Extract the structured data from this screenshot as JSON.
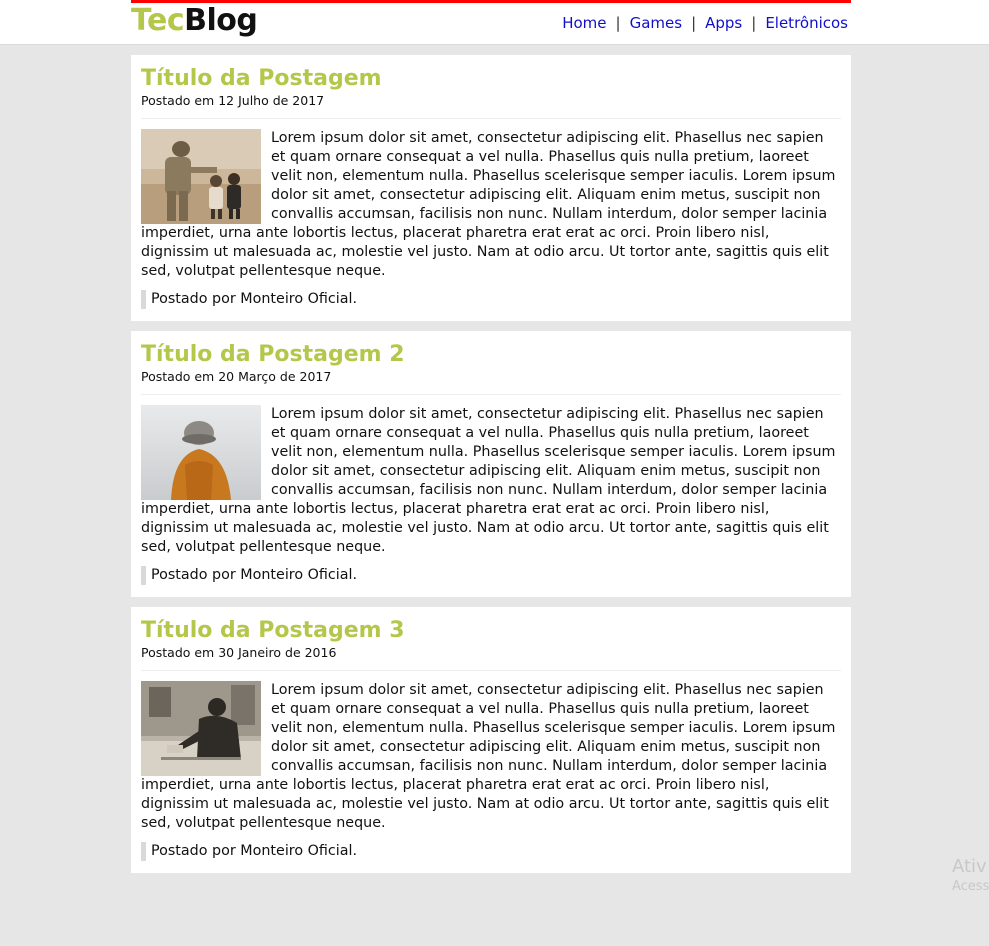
{
  "header": {
    "logo_part1": "Tec",
    "logo_part2": "Blog",
    "nav": [
      "Home",
      "Games",
      "Apps",
      "Eletrônicos"
    ],
    "separator": "|"
  },
  "posts": [
    {
      "title": "Título da Postagem",
      "date": "Postado em 12 Julho de 2017",
      "image": "soldier-with-children",
      "body": "Lorem ipsum dolor sit amet, consectetur adipiscing elit. Phasellus nec sapien et quam ornare consequat a vel nulla. Phasellus quis nulla pretium, laoreet velit non, elementum nulla. Phasellus scelerisque semper iaculis. Lorem ipsum dolor sit amet, consectetur adipiscing elit. Aliquam enim metus, suscipit non convallis accumsan, facilisis non nunc. Nullam interdum, dolor semper lacinia imperdiet, urna ante lobortis lectus, placerat pharetra erat erat ac orci. Proin libero nisl, dignissim ut malesuada ac, molestie vel justo. Nam at odio arcu. Ut tortor ante, sagittis quis elit sed, volutpat pellentesque neque.",
      "byline": "Postado por Monteiro Oficial."
    },
    {
      "title": "Título da Postagem 2",
      "date": "Postado em 20 Março de 2017",
      "image": "person-in-orange-jacket",
      "body": "Lorem ipsum dolor sit amet, consectetur adipiscing elit. Phasellus nec sapien et quam ornare consequat a vel nulla. Phasellus quis nulla pretium, laoreet velit non, elementum nulla. Phasellus scelerisque semper iaculis. Lorem ipsum dolor sit amet, consectetur adipiscing elit. Aliquam enim metus, suscipit non convallis accumsan, facilisis non nunc. Nullam interdum, dolor semper lacinia imperdiet, urna ante lobortis lectus, placerat pharetra erat erat ac orci. Proin libero nisl, dignissim ut malesuada ac, molestie vel justo. Nam at odio arcu. Ut tortor ante, sagittis quis elit sed, volutpat pellentesque neque.",
      "byline": "Postado por Monteiro Oficial."
    },
    {
      "title": "Título da Postagem 3",
      "date": "Postado em 30 Janeiro de 2016",
      "image": "old-man-street-photo",
      "body": "Lorem ipsum dolor sit amet, consectetur adipiscing elit. Phasellus nec sapien et quam ornare consequat a vel nulla. Phasellus quis nulla pretium, laoreet velit non, elementum nulla. Phasellus scelerisque semper iaculis. Lorem ipsum dolor sit amet, consectetur adipiscing elit. Aliquam enim metus, suscipit non convallis accumsan, facilisis non nunc. Nullam interdum, dolor semper lacinia imperdiet, urna ante lobortis lectus, placerat pharetra erat erat ac orci. Proin libero nisl, dignissim ut malesuada ac, molestie vel justo. Nam at odio arcu. Ut tortor ante, sagittis quis elit sed, volutpat pellentesque neque.",
      "byline": "Postado por Monteiro Oficial."
    }
  ],
  "watermark": {
    "line1": "Ativ",
    "line2": "Acess"
  },
  "colors": {
    "accent": "#b5c74a",
    "header_border": "#ff0000",
    "link": "#1010cc",
    "background": "#e6e6e6"
  }
}
